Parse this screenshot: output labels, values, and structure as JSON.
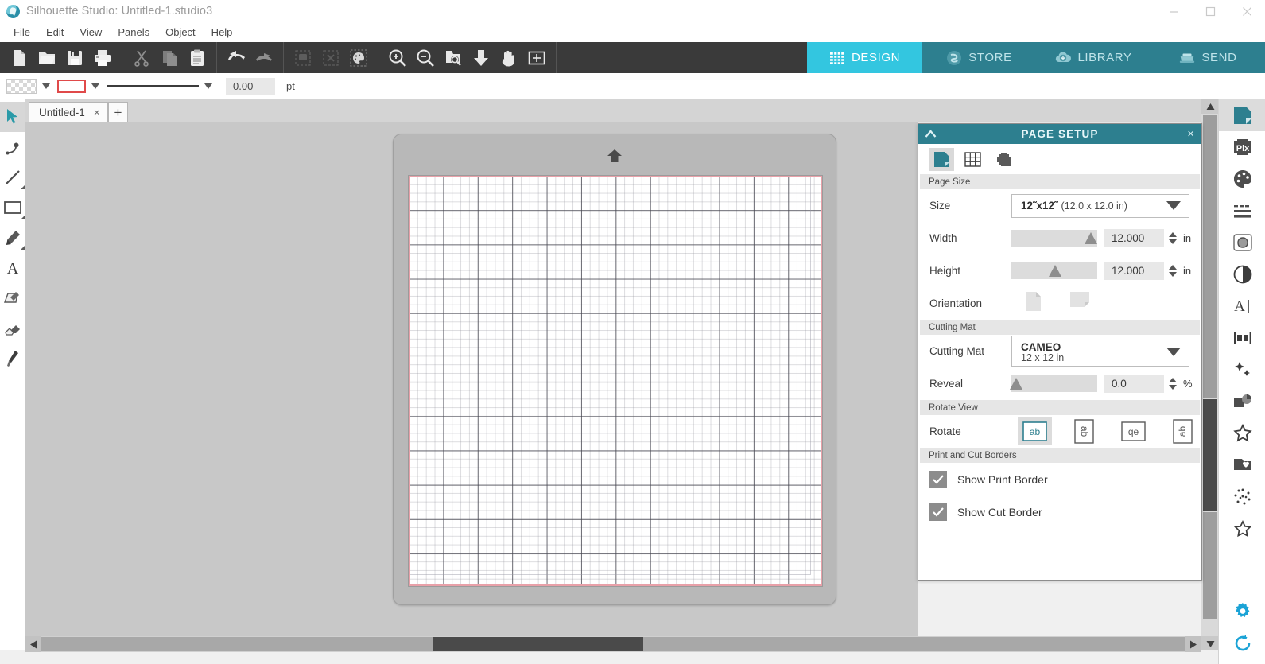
{
  "window": {
    "title": "Silhouette Studio: Untitled-1.studio3",
    "logo_icon": "silhouette-logo-icon",
    "minimize_label": "Minimize",
    "maximize_label": "Maximize",
    "close_label": "Close"
  },
  "menu": {
    "items": [
      {
        "label": "File",
        "accel": "F"
      },
      {
        "label": "Edit",
        "accel": "E"
      },
      {
        "label": "View",
        "accel": "V"
      },
      {
        "label": "Panels",
        "accel": "P"
      },
      {
        "label": "Object",
        "accel": "O"
      },
      {
        "label": "Help",
        "accel": "H"
      }
    ]
  },
  "toolbar": {
    "groups": [
      {
        "buttons": [
          {
            "name": "new-document",
            "icon": "new-page-icon"
          },
          {
            "name": "open-document",
            "icon": "folder-open-icon"
          },
          {
            "name": "save-document",
            "icon": "floppy-save-icon"
          },
          {
            "name": "print-document",
            "icon": "printer-icon"
          }
        ]
      },
      {
        "buttons": [
          {
            "name": "cut",
            "icon": "scissors-icon"
          },
          {
            "name": "copy",
            "icon": "copy-icon"
          },
          {
            "name": "paste",
            "icon": "clipboard-icon"
          }
        ]
      },
      {
        "buttons": [
          {
            "name": "undo",
            "icon": "undo-arrow-icon"
          },
          {
            "name": "redo",
            "icon": "redo-arrow-icon"
          }
        ]
      },
      {
        "buttons": [
          {
            "name": "select-all",
            "icon": "select-all-icon"
          },
          {
            "name": "deselect-all",
            "icon": "deselect-icon"
          },
          {
            "name": "trace-selection",
            "icon": "trace-palette-icon"
          }
        ]
      },
      {
        "buttons": [
          {
            "name": "zoom-in",
            "icon": "zoom-in-icon"
          },
          {
            "name": "zoom-out",
            "icon": "zoom-out-icon"
          },
          {
            "name": "zoom-region",
            "icon": "zoom-region-icon"
          },
          {
            "name": "fit-to-window",
            "icon": "fit-down-arrow-icon"
          },
          {
            "name": "pan-hand",
            "icon": "hand-icon"
          },
          {
            "name": "fit-to-page",
            "icon": "fit-page-icon"
          }
        ]
      }
    ],
    "modes": [
      {
        "label": "DESIGN",
        "icon": "grid-icon",
        "active": true
      },
      {
        "label": "STORE",
        "icon": "silhouette-logo-icon",
        "active": false
      },
      {
        "label": "LIBRARY",
        "icon": "cloud-download-icon",
        "active": false
      },
      {
        "label": "SEND",
        "icon": "cutter-machine-icon",
        "active": false
      }
    ]
  },
  "stylebar": {
    "fill_swatch_name": "fill-color-none",
    "line_swatch_name": "line-color-red",
    "line_color": "#e04a4a",
    "line_style_name": "solid-line",
    "thickness_value": "0.00",
    "thickness_unit": "pt"
  },
  "doc_tabs": {
    "tabs": [
      {
        "label": "Untitled-1",
        "close": "×"
      }
    ],
    "add_label": "+"
  },
  "left_tools": [
    {
      "name": "select-tool",
      "icon": "arrow-cursor-icon",
      "active": true,
      "flyout": false
    },
    {
      "name": "edit-points-tool",
      "icon": "node-edit-icon",
      "active": false,
      "flyout": false
    },
    {
      "name": "line-tool",
      "icon": "line-icon",
      "active": false,
      "flyout": true
    },
    {
      "name": "rectangle-tool",
      "icon": "rectangle-icon",
      "active": false,
      "flyout": true
    },
    {
      "name": "draw-tool",
      "icon": "pencil-icon",
      "active": false,
      "flyout": true
    },
    {
      "name": "text-tool",
      "icon": "text-a-icon",
      "active": false,
      "flyout": false
    },
    {
      "name": "trace-tool",
      "icon": "trace-icon",
      "active": false,
      "flyout": false
    },
    {
      "name": "eraser-tool",
      "icon": "eraser-icon",
      "active": false,
      "flyout": false
    },
    {
      "name": "knife-tool",
      "icon": "knife-icon",
      "active": false,
      "flyout": false
    }
  ],
  "right_rail": [
    {
      "name": "page-setup-panel",
      "icon": "page-setup-icon",
      "active": true
    },
    {
      "name": "pixscan-panel",
      "icon": "pixscan-icon",
      "active": false
    },
    {
      "name": "fill-color-panel",
      "icon": "palette-icon",
      "active": false
    },
    {
      "name": "line-style-panel",
      "icon": "line-style-icon",
      "active": false
    },
    {
      "name": "trace-panel",
      "icon": "trace-shape-icon",
      "active": false
    },
    {
      "name": "transparency-panel",
      "icon": "opacity-circle-icon",
      "active": false
    },
    {
      "name": "text-style-panel",
      "icon": "text-cursor-icon",
      "active": false
    },
    {
      "name": "align-panel",
      "icon": "align-icon",
      "active": false
    },
    {
      "name": "modify-panel",
      "icon": "sparkle-icon",
      "active": false
    },
    {
      "name": "image-effects-panel",
      "icon": "image-effects-icon",
      "active": false
    },
    {
      "name": "shapes-panel",
      "icon": "star-shape-icon",
      "active": false
    },
    {
      "name": "library-panel",
      "icon": "library-heart-icon",
      "active": false
    },
    {
      "name": "stipple-panel",
      "icon": "dots-pattern-icon",
      "active": false
    },
    {
      "name": "my-designs-panel",
      "icon": "star-outline-icon",
      "active": false
    }
  ],
  "right_rail_bottom": [
    {
      "name": "preferences-button",
      "icon": "gear-icon",
      "color": "#1ba3d6"
    },
    {
      "name": "sync-button",
      "icon": "sync-refresh-icon",
      "color": "#1ba3d6"
    }
  ],
  "canvas": {
    "mat_arrow_name": "mat-load-direction-arrow",
    "cut_border_color": "#e8a0a8",
    "print_border_color": "#9696a5"
  },
  "panel": {
    "title": "PAGE SETUP",
    "collapse_icon": "chevron-up-icon",
    "close_icon": "close-x-icon",
    "close_label": "×",
    "tabs": [
      {
        "name": "page-tab",
        "icon": "page-icon",
        "active": true
      },
      {
        "name": "grid-tab",
        "icon": "grid-table-icon",
        "active": false
      },
      {
        "name": "registration-marks-tab",
        "icon": "reg-marks-icon",
        "active": false
      }
    ],
    "sections": {
      "page_size": "Page Size",
      "cutting_mat": "Cutting Mat",
      "rotate_view": "Rotate View",
      "print_cut_borders": "Print and Cut Borders"
    },
    "size": {
      "label": "Size",
      "value_main": "12˜x12˜",
      "value_sub": "(12.0 x 12.0 in)"
    },
    "width": {
      "label": "Width",
      "value": "12.000",
      "unit": "in"
    },
    "height": {
      "label": "Height",
      "value": "12.000",
      "unit": "in"
    },
    "orientation": {
      "label": "Orientation",
      "options": [
        {
          "name": "orientation-portrait",
          "icon": "portrait-page-icon"
        },
        {
          "name": "orientation-landscape",
          "icon": "landscape-page-icon"
        }
      ]
    },
    "cutting_mat": {
      "label": "Cutting Mat",
      "value_main": "CAMEO",
      "value_sub": "12 x 12 in"
    },
    "reveal": {
      "label": "Reveal",
      "value": "0.0",
      "unit": "%"
    },
    "rotate": {
      "label": "Rotate",
      "options": [
        {
          "name": "rotate-0",
          "text": "ab",
          "active": true
        },
        {
          "name": "rotate-90",
          "text": "ab",
          "active": false
        },
        {
          "name": "rotate-180",
          "text": "qe",
          "active": false
        },
        {
          "name": "rotate-270",
          "text": "ab",
          "active": false
        }
      ]
    },
    "checkboxes": [
      {
        "name": "show-print-border-checkbox",
        "label": "Show Print Border",
        "checked": true
      },
      {
        "name": "show-cut-border-checkbox",
        "label": "Show Cut Border",
        "checked": true
      }
    ]
  }
}
